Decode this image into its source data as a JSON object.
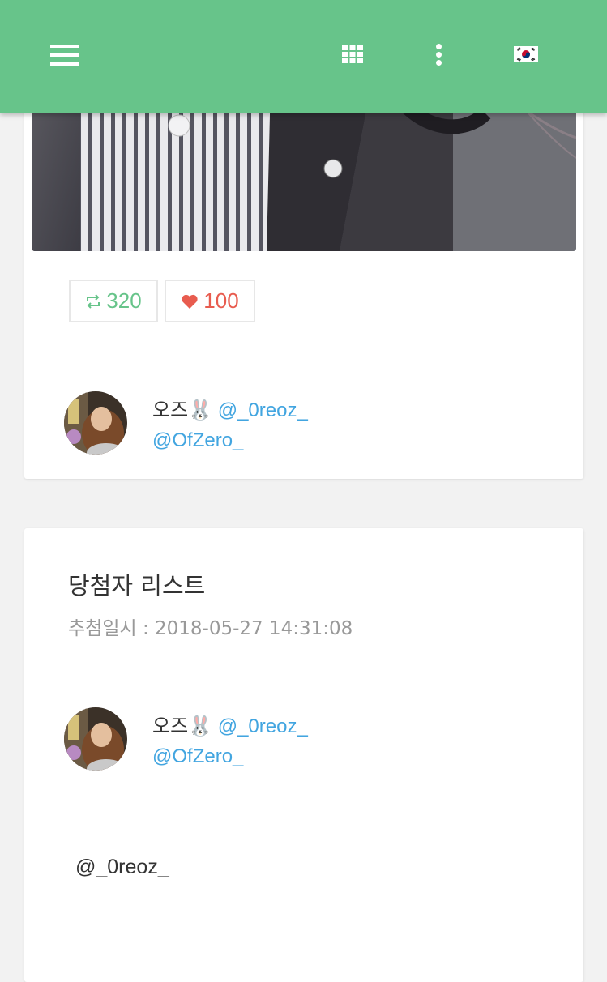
{
  "header": {
    "menu_icon": "hamburger-menu-icon",
    "apps_icon": "grid-apps-icon",
    "more_icon": "vertical-dots-icon",
    "language_icon": "korea-flag-icon",
    "accent_color": "#67c48a"
  },
  "tweet_card": {
    "retweet_count": "320",
    "like_count": "100",
    "retweet_color": "#67c48a",
    "like_color": "#e85c4f",
    "author": {
      "display_name": "오즈🐰",
      "handle": "@_0reoz_",
      "secondary_handle": "@OfZero_"
    }
  },
  "winners_card": {
    "title": "당첨자 리스트",
    "draw_date": "추첨일시 : 2018-05-27 14:31:08",
    "winner": {
      "display_name": "오즈🐰",
      "handle": "@_0reoz_",
      "secondary_handle": "@OfZero_"
    },
    "winner_list": [
      "@_0reoz_"
    ]
  }
}
